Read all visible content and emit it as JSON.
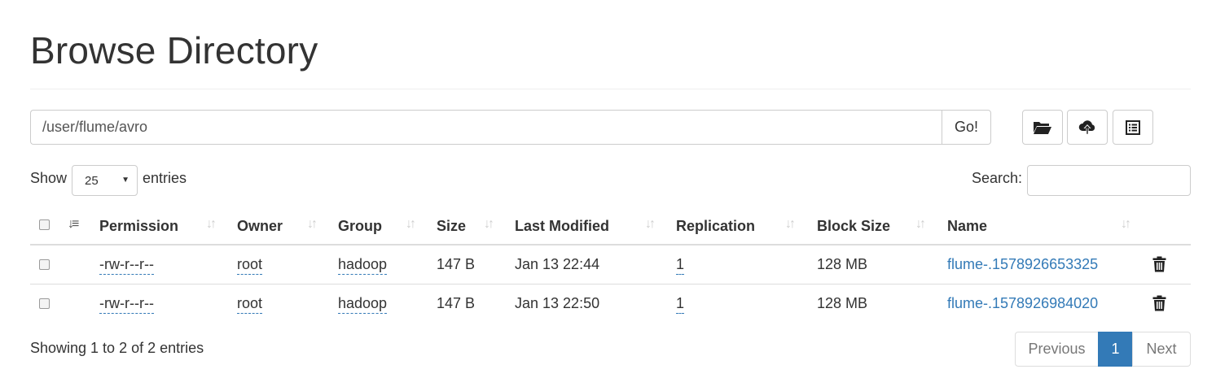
{
  "page": {
    "title": "Browse Directory"
  },
  "path_bar": {
    "value": "/user/flume/avro",
    "go_label": "Go!"
  },
  "toolbar": [
    {
      "name": "create-directory-icon"
    },
    {
      "name": "upload-icon"
    },
    {
      "name": "cut-paste-icon"
    }
  ],
  "length": {
    "show_label": "Show",
    "value": "25",
    "entries_label": "entries"
  },
  "search": {
    "label": "Search:",
    "value": ""
  },
  "table": {
    "headers": {
      "permission": "Permission",
      "owner": "Owner",
      "group": "Group",
      "size": "Size",
      "last_modified": "Last Modified",
      "replication": "Replication",
      "block_size": "Block Size",
      "name": "Name"
    },
    "rows": [
      {
        "permission": "-rw-r--r--",
        "owner": "root",
        "group": "hadoop",
        "size": "147 B",
        "last_modified": "Jan 13 22:44",
        "replication": "1",
        "block_size": "128 MB",
        "name": "flume-.1578926653325"
      },
      {
        "permission": "-rw-r--r--",
        "owner": "root",
        "group": "hadoop",
        "size": "147 B",
        "last_modified": "Jan 13 22:50",
        "replication": "1",
        "block_size": "128 MB",
        "name": "flume-.1578926984020"
      }
    ]
  },
  "footer": {
    "info": "Showing 1 to 2 of 2 entries",
    "pagination": {
      "previous": "Previous",
      "current": "1",
      "next": "Next"
    }
  },
  "colors": {
    "link": "#337ab7",
    "active_page": "#337ab7",
    "border": "#dddddd"
  }
}
